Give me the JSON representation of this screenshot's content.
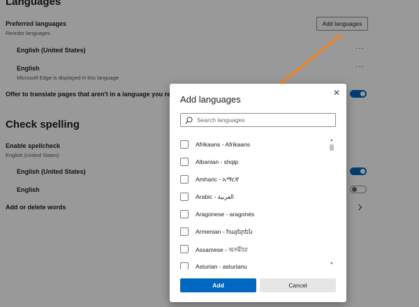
{
  "settings": {
    "languages_heading": "Languages",
    "preferred_label": "Preferred languages",
    "reorder_label": "Reorder languages",
    "add_languages_button": "Add languages",
    "preferred_items": [
      {
        "name": "English (United States)",
        "note": ""
      },
      {
        "name": "English",
        "note": "Microsoft Edge is displayed in this language"
      }
    ],
    "more_actions": "···",
    "offer_translate_label": "Offer to translate pages that aren't in a language you read",
    "spelling_heading": "Check spelling",
    "enable_spellcheck_label": "Enable spellcheck",
    "enable_spellcheck_sub": "English (United States)",
    "spell_items": [
      {
        "name": "English (United States)",
        "on": true
      },
      {
        "name": "English",
        "on": false
      }
    ],
    "add_delete_words": "Add or delete words"
  },
  "dialog": {
    "title": "Add languages",
    "close_glyph": "✕",
    "search_placeholder": "Search languages",
    "languages": [
      "Afrikaans - Afrikaans",
      "Albanian - shqip",
      "Amharic - አማርኛ",
      "Arabic - العربية",
      "Aragonese - aragonés",
      "Armenian - հայերեն",
      "Assamese - অসমীয়া",
      "Asturian - asturianu"
    ],
    "add_button": "Add",
    "cancel_button": "Cancel"
  },
  "colors": {
    "accent": "#0067c0",
    "annotation_arrow": "#f5841f"
  }
}
